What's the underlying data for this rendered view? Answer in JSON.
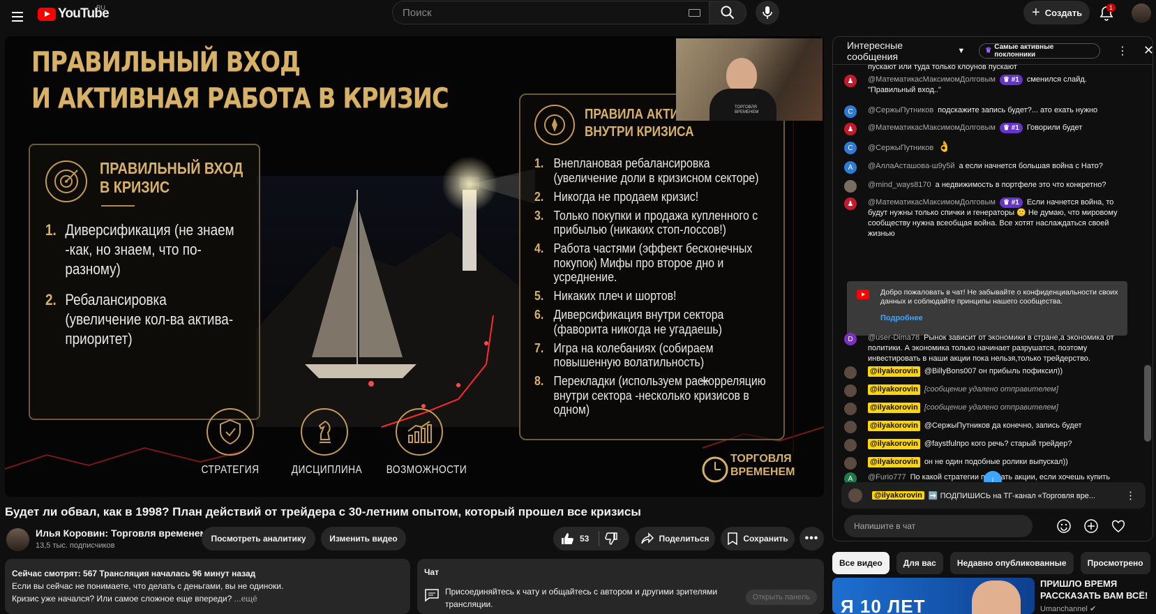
{
  "header": {
    "logo_text": "YouTube",
    "logo_country": "RU",
    "search_placeholder": "Поиск",
    "create_label": "Создать",
    "notifications_count": "1"
  },
  "player": {
    "slide": {
      "title_line1": "ПРАВИЛЬНЫЙ ВХОД",
      "title_line2": "И АКТИВНАЯ РАБОТА В КРИЗИС",
      "left_heading_1": "ПРАВИЛЬНЫЙ ВХОД",
      "left_heading_2": "В КРИЗИС",
      "left_items": [
        {
          "num": "1.",
          "text": "Диверсификация (не знаем -как, но знаем, что по-разному)"
        },
        {
          "num": "2.",
          "text": "Ребалансировка (увеличение кол-ва актива-приоритет)"
        }
      ],
      "right_heading_1": "ПРАВИЛА АКТИВ",
      "right_heading_2": "ВНУТРИ КРИЗИСА",
      "right_items": [
        {
          "num": "1.",
          "text": "Внеплановая ребалансировка (увеличение доли в кризисном секторе)"
        },
        {
          "num": "2.",
          "text": "Никогда не продаем кризис!"
        },
        {
          "num": "3.",
          "text": "Только покупки и продажа купленного с прибылью (никаких стоп-лоссов!)"
        },
        {
          "num": "4.",
          "text": "Работа частями (эффект бесконечных покупок) Мифы про второе дно и усреднение."
        },
        {
          "num": "5.",
          "text": "Никаких плеч и шортов!"
        },
        {
          "num": "6.",
          "text": "Диверсификация внутри сектора (фаворита никогда не угадаешь)"
        },
        {
          "num": "7.",
          "text": "Игра на колебаниях (собираем повышенную волатильность)"
        },
        {
          "num": "8.",
          "text": "Перекладки (используем раскорреляцию внутри сектора -несколько кризисов в одном)"
        }
      ],
      "tiles": [
        "СТРАТЕГИЯ",
        "ДИСЦИПЛИНА",
        "ВОЗМОЖНОСТИ"
      ],
      "brand_line1": "ТОРГОВЛЯ",
      "brand_line2": "ВРЕМЕНЕМ",
      "webcam_shirt_text": "ТОРГОВЛЯ ВРЕМЕНЕМ"
    }
  },
  "video": {
    "title": "Будет ли обвал, как в 1998? План действий от трейдера с 30-летним опытом, который прошел все кризисы",
    "channel_name": "Илья Коровин: Торговля временем",
    "subscribers": "13,5 тыс. подписчиков",
    "analytics_label": "Посмотреть аналитику",
    "edit_label": "Изменить видео",
    "likes": "53",
    "share_label": "Поделиться",
    "save_label": "Сохранить"
  },
  "description": {
    "stats": "Сейчас смотрят: 567  Трансляция началась 96 минут назад",
    "line1": "Если вы сейчас не понимаете, что делать с деньгами, вы не одиноки.",
    "line2": "Кризис уже начался? Или самое сложное еще впереди?",
    "more": "...ещё"
  },
  "chat_promo": {
    "title": "Чат",
    "text": "Присоединяйтесь к чату и общайтесь с автором и другими зрителями трансляции.",
    "open_label": "Открыть панель"
  },
  "chat": {
    "header_mode": "Интересные сообщения",
    "fans_label": "Самые активные поклонники",
    "messages": [
      {
        "author": "",
        "text": "пускают или туда только клоунов пускают"
      },
      {
        "author": "@МатематикасМаксимомДолговым",
        "badge": "#1",
        "text": "сменился слайд. \"Правильный вход..\""
      },
      {
        "author": "@СержыПутников",
        "text": "подскажите запись будет?... ато ехать нужно"
      },
      {
        "author": "@МатематикасМаксимомДолговым",
        "badge": "#1",
        "text": "Говорили будет"
      },
      {
        "author": "@СержыПутников",
        "text": "👌"
      },
      {
        "author": "@АллаАсташова-ш9у5й",
        "text": "а если начнется большая война с Нато?"
      },
      {
        "author": "@mind_ways8170",
        "text": "а недвижимость в портфеле это что конкретно?"
      },
      {
        "author": "@МатематикасМаксимомДолговым",
        "badge": "#1",
        "text": "Если начнется война, то будут нужны только спички и генераторы 🙂 Не думаю, что мировому сообществу нужна всеобщая война. Все хотят наслаждаться своей жизнью"
      },
      {
        "author": "@user-Dima78",
        "text": "Рынок зависит от экономики в стране,а экономика от политики. А экономика только начинает разрушатся, поэтому инвестировать в наши акции пока нельзя,только трейдерство."
      },
      {
        "author": "@ilyakorovin",
        "text": "@BillyBons007 он прибыль пофиксил))"
      },
      {
        "author": "@ilyakorovin",
        "text": "[сообщение удалено отправителем]"
      },
      {
        "author": "@ilyakorovin",
        "text": "[сообщение удалено отправителем]"
      },
      {
        "author": "@ilyakorovin",
        "text": "@СержыПутников да конечно, запись будет"
      },
      {
        "author": "@ilyakorovin",
        "text": "@faystfulпро кого речь? старый трейдер?"
      },
      {
        "author": "@ilyakorovin",
        "text": "он не один подобные ролики выпускал))"
      },
      {
        "author": "@Furio777",
        "text": "По какой стратегии покупать акции, если хочешь купить максимальное количество с минимальной средней? Ежемесячно одной суммой, держать кэш в надежде на падение -20%, -40% и т.д.?"
      }
    ],
    "welcome_text": "Добро пожаловать в чат! Не забывайте о конфиденциальности своих данных и соблюдайте принципы нашего сообщества.",
    "welcome_link": "Подробнее",
    "pinned_author": "@ilyakorovin",
    "pinned_text": "➡️ ПОДПИШИСЬ на ТГ-канал «Торговля вре...",
    "input_placeholder": "Напишите в чат"
  },
  "filters": [
    "Все видео",
    "Для вас",
    "Недавно опубликованные",
    "Просмотрено"
  ],
  "recommendation": {
    "thumb_text": "Я 10 ЛЕТ",
    "title": "ПРИШЛО ВРЕМЯ РАССКАЗАТЬ ВАМ ВСЁ!",
    "channel": "Umanchannel"
  },
  "colors": {
    "brand_red": "#ff0000",
    "gold": "#d8b169",
    "owner_badge": "#ffd600",
    "member_badge": "#6633cc"
  }
}
